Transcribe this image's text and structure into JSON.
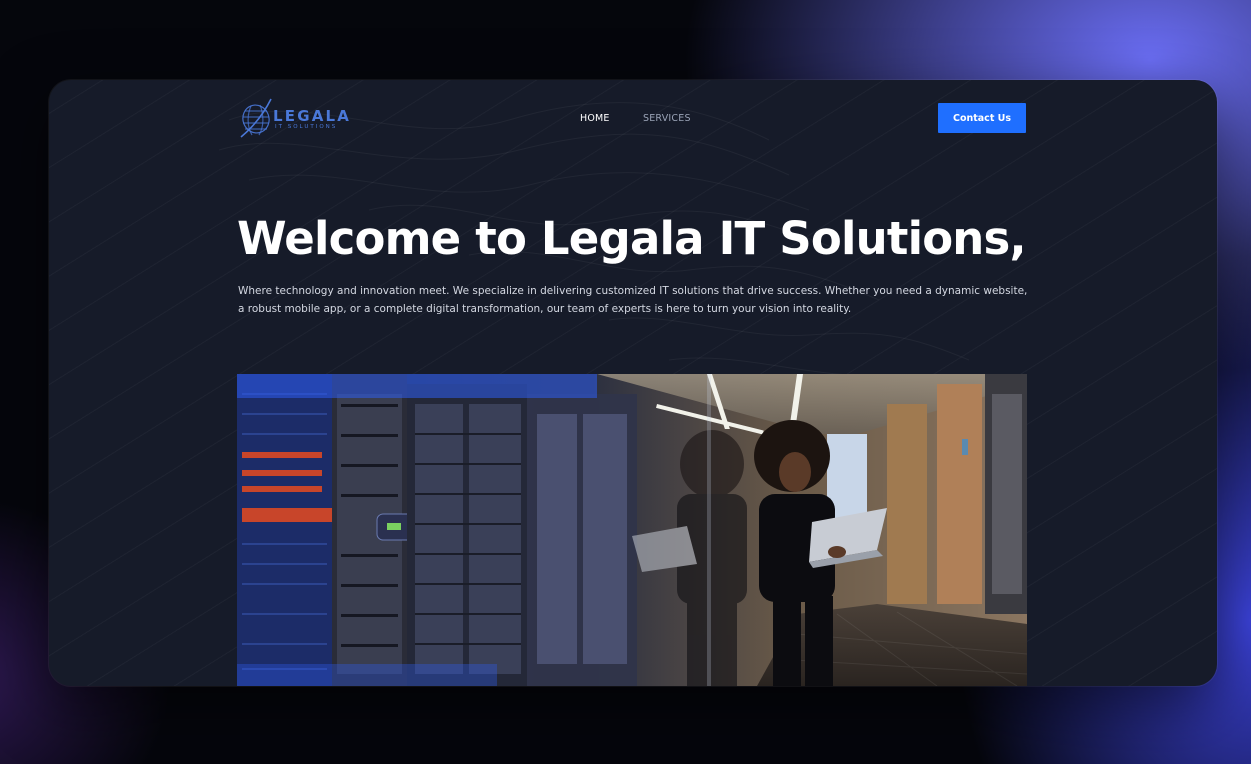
{
  "brand": {
    "name": "LEGALA",
    "tagline": "IT SOLUTIONS"
  },
  "nav": {
    "items": [
      {
        "label": "HOME",
        "active": true
      },
      {
        "label": "SERVICES",
        "active": false
      }
    ],
    "cta_label": "Contact Us"
  },
  "hero": {
    "title": "Welcome to Legala IT Solutions,",
    "description": "Where technology and innovation meet. We specialize in delivering customized IT solutions that drive success. Whether you need a dynamic website, a robust mobile app, or a complete digital transformation, our team of experts is here to turn your vision into reality."
  },
  "colors": {
    "accent": "#1f6fff",
    "page_bg": "#161b29",
    "logo": "#4a78d8",
    "nav_active": "#ffffff",
    "nav_inactive": "#9aa3b6"
  }
}
